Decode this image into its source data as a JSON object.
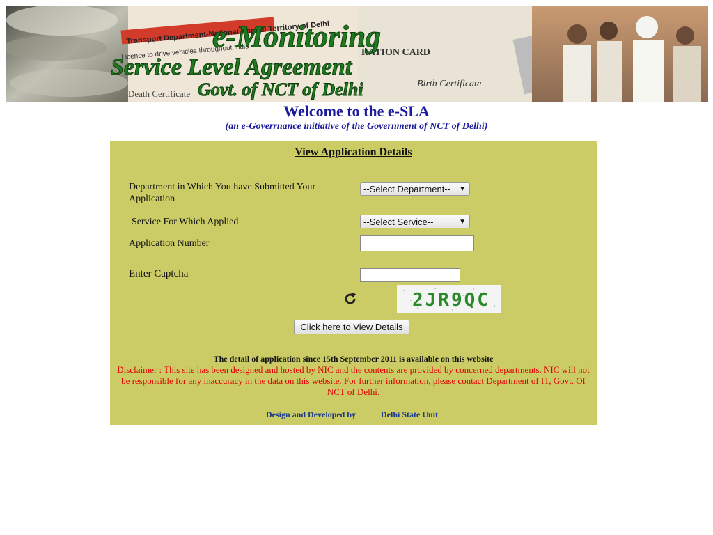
{
  "banner": {
    "title_line1": "e-Monitoring",
    "title_line2": "Service Level Agreement",
    "title_line3": "Govt. of NCT of Delhi",
    "doc_text_1": "Transport Department-National Capital Territory of Delhi",
    "doc_text_2": "Licence to drive vehicles throughout India",
    "doc_text_3": "RATION CARD",
    "doc_text_4": "Birth Certificate",
    "doc_text_5": "Death Certificate"
  },
  "header": {
    "welcome": "Welcome to the e-SLA",
    "subtitle": "(an e-Goverrnance initiative of the Government of NCT of Delhi)"
  },
  "form": {
    "title": "View Application Details",
    "department_label": "Department in Which You have Submitted Your Application",
    "department_value": "--Select Department--",
    "service_label": "Service For Which Applied",
    "service_value": "--Select Service--",
    "application_number_label": "Application Number",
    "application_number_value": "",
    "captcha_label": "Enter Captcha",
    "captcha_value": "",
    "captcha_text": "2JR9QC",
    "submit_label": "Click here to View Details"
  },
  "notes": {
    "availability": "The detail of application since 15th September 2011 is available on this website",
    "disclaimer": "Disclaimer : This site has been designed and hosted by NIC and the contents are provided by concerned departments. NIC will not be responsible for any inaccuracy in the data on this website. For further information, please contact Department of IT, Govt. Of NCT of Delhi."
  },
  "footer": {
    "designed_by": "Design and Developed by",
    "unit": "Delhi State Unit"
  },
  "colors": {
    "panel_bg": "#cccc66",
    "heading_blue": "#1a1a9c",
    "disclaimer_red": "#e00000",
    "banner_green": "#1f7a1f"
  }
}
